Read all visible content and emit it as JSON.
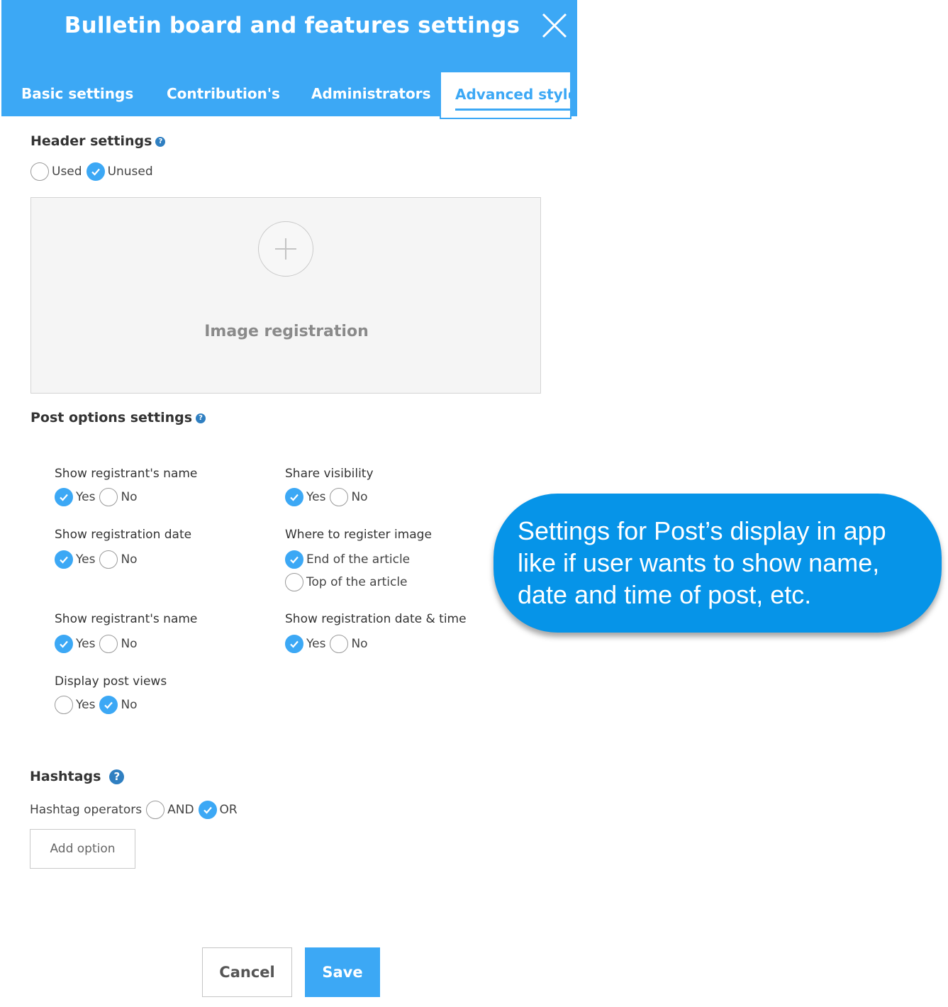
{
  "header": {
    "title": "Bulletin board and features settings",
    "close_icon": "close-icon"
  },
  "tabs": [
    {
      "label": "Basic settings",
      "active": false
    },
    {
      "label": "Contribution's",
      "active": false
    },
    {
      "label": "Administrators",
      "active": false
    },
    {
      "label": "Advanced style",
      "active": true
    }
  ],
  "header_settings": {
    "title": "Header settings",
    "help_glyph": "?",
    "options": [
      {
        "label": "Used",
        "checked": false
      },
      {
        "label": "Unused",
        "checked": true
      }
    ],
    "image_label": "Image registration"
  },
  "post_options": {
    "title": "Post options settings",
    "groups": {
      "show_name_1": {
        "label": "Show registrant's name",
        "yes": "Yes",
        "no": "No",
        "selected": "yes"
      },
      "share_visibility": {
        "label": "Share visibility",
        "yes": "Yes",
        "no": "No",
        "selected": "yes"
      },
      "show_date": {
        "label": "Show registration date",
        "yes": "Yes",
        "no": "No",
        "selected": "yes"
      },
      "register_image": {
        "label": "Where to register image",
        "opt1": "End of the article",
        "opt2": "Top of the article",
        "selected": "end"
      },
      "show_name_2": {
        "label": "Show registrant's name",
        "yes": "Yes",
        "no": "No",
        "selected": "yes"
      },
      "show_date_time": {
        "label": "Show registration date & time",
        "yes": "Yes",
        "no": "No",
        "selected": "yes"
      },
      "post_views": {
        "label": "Display post views",
        "yes": "Yes",
        "no": "No",
        "selected": "no"
      }
    }
  },
  "hashtags": {
    "title": "Hashtags",
    "operators_label": "Hashtag operators",
    "and": "AND",
    "or": "OR",
    "selected": "or",
    "add_option": "Add option"
  },
  "footer": {
    "cancel": "Cancel",
    "save": "Save"
  },
  "callout": {
    "text": "Settings for Post’s display in app like if user wants to show name, date and time of post, etc."
  },
  "colors": {
    "accent": "#3ca8f5",
    "callout": "#0694e8",
    "help": "#2f7fc1"
  }
}
